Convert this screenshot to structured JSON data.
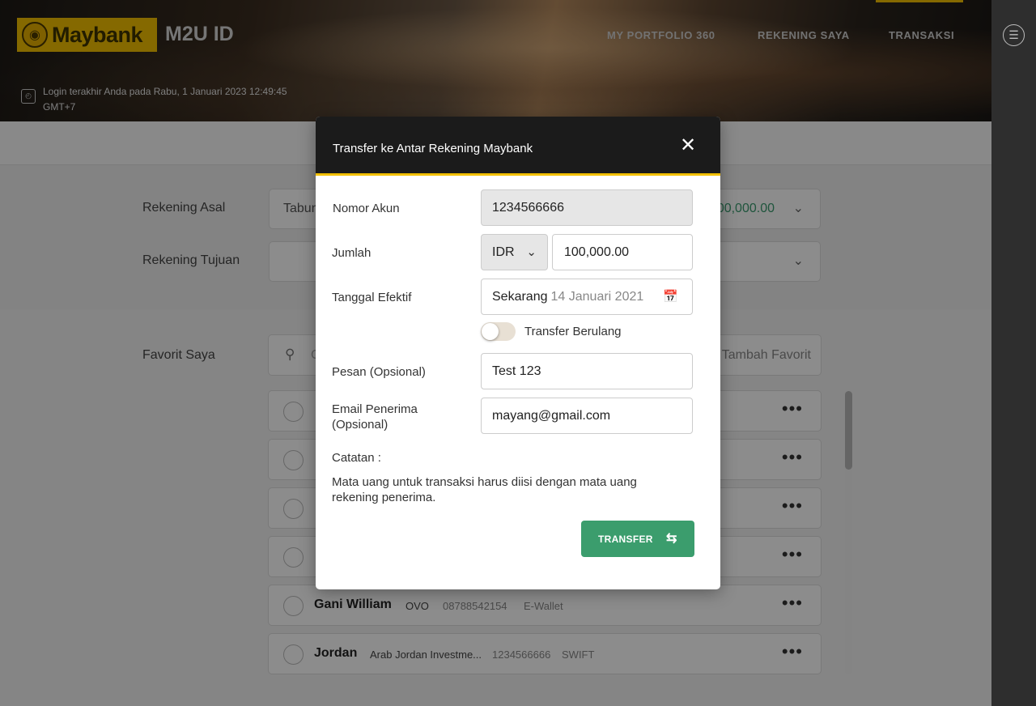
{
  "header": {
    "brand": "Maybank",
    "app_name": "M2U ID",
    "nav": [
      "MY PORTFOLIO 360",
      "REKENING SAYA",
      "TRANSAKSI"
    ],
    "last_login_line1": "Login terakhir Anda pada Rabu, 1 Januari 2023 12:49:45",
    "last_login_line2": "GMT+7"
  },
  "form": {
    "source_label": "Rekening Asal",
    "source_value": "Tabun",
    "source_amount": "00,000.00",
    "dest_label": "Rekening Tujuan",
    "favorites_label": "Favorit Saya",
    "search_placeholder": "C",
    "add_favorite": "Tambah Favorit"
  },
  "favorites": [
    {
      "name": "Gani William",
      "bank": "OVO",
      "account": "08788542154",
      "type": "E-Wallet"
    },
    {
      "name": "Jordan",
      "bank": "Arab Jordan Investme...",
      "account": "1234566666",
      "type": "SWIFT"
    }
  ],
  "modal": {
    "title": "Transfer ke Antar Rekening Maybank",
    "account_label": "Nomor Akun",
    "account_value": "1234566666",
    "amount_label": "Jumlah",
    "currency": "IDR",
    "amount_value": "100,000.00",
    "date_label": "Tanggal Efektif",
    "date_now": "Sekarang",
    "date_value": "14 Januari 2021",
    "recurring_label": "Transfer Berulang",
    "recurring_on": false,
    "message_label": "Pesan (Opsional)",
    "message_value": "Test 123",
    "email_label_1": "Email Penerima",
    "email_label_2": "(Opsional)",
    "email_value": "mayang@gmail.com",
    "note_title": "Catatan :",
    "note_text": "Mata uang untuk transaksi harus diisi dengan mata uang rekening penerima.",
    "submit_label": "TRANSFER"
  },
  "colors": {
    "brand_yellow": "#f2c000",
    "accent_green": "#3b9d6d"
  }
}
